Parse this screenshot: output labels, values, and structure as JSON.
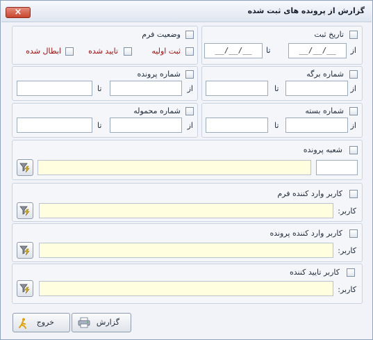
{
  "window": {
    "title": "گزارش از پرونده های ثبت شده",
    "close_label": "×"
  },
  "labels": {
    "from": "از",
    "to": "تا",
    "user": "کاربر:"
  },
  "registration_date": {
    "label": "تاریخ ثبت",
    "from_value": "__/__/__",
    "to_value": "__/__/__"
  },
  "form_status": {
    "label": "وضعیت فرم",
    "options": [
      "ثبت اولیه",
      "تایید شده",
      "ابطال شده"
    ]
  },
  "sheet_number": {
    "label": "شماره برگه"
  },
  "file_number": {
    "label": "شماره پرونده"
  },
  "package_number": {
    "label": "شماره بسته"
  },
  "shipment_number": {
    "label": "شماره محموله"
  },
  "file_branch": {
    "label": "شعبه پرونده"
  },
  "form_entry_user": {
    "label": "کاربر وارد کننده فرم"
  },
  "file_entry_user": {
    "label": "کاربر وارد کننده پرونده"
  },
  "approver_user": {
    "label": "کاربر تایید کننده"
  },
  "footer": {
    "report_label": "گزارش",
    "exit_label": "خروج"
  }
}
